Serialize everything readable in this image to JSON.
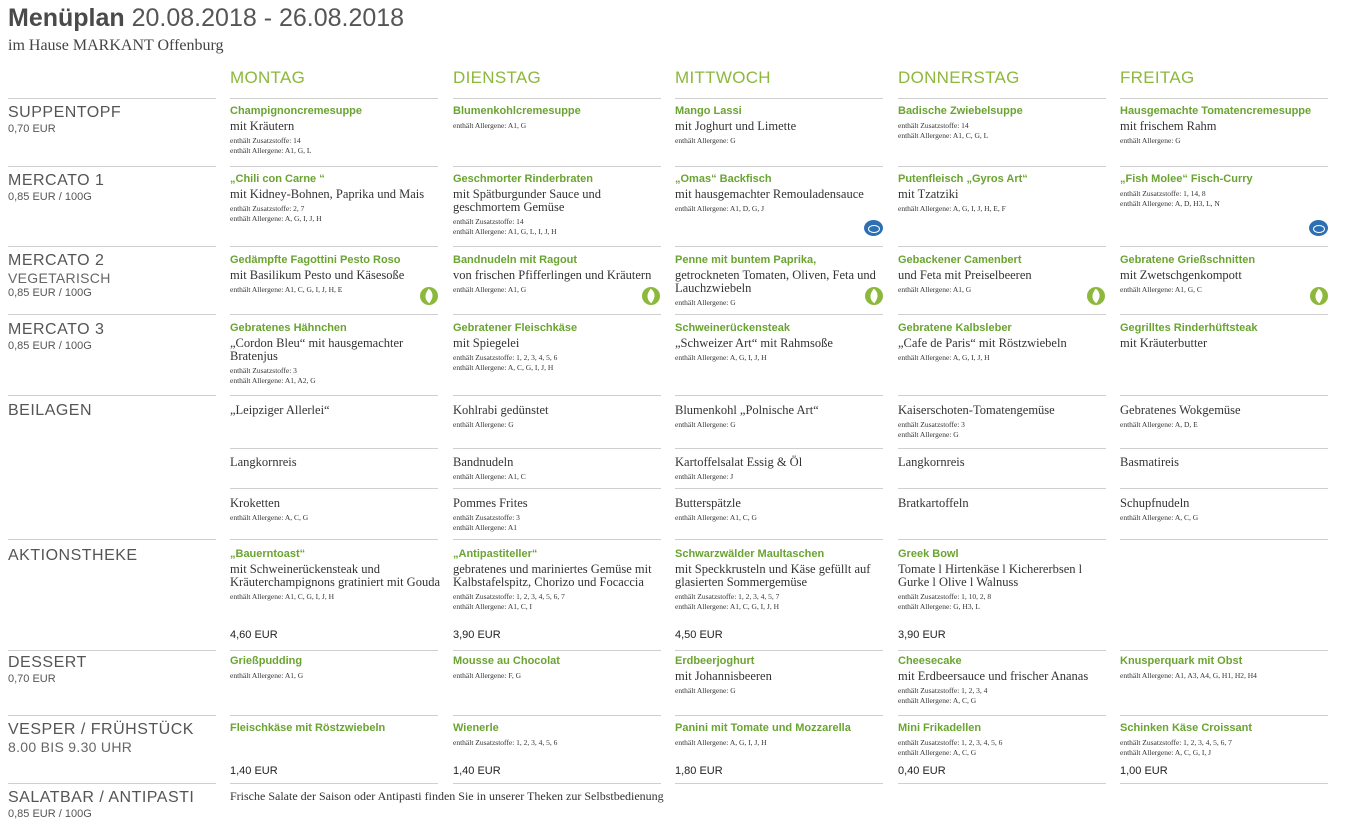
{
  "header": {
    "title": "Menüplan",
    "date_range": "20.08.2018 - 26.08.2018",
    "subtitle": "im Hause MARKANT Offenburg"
  },
  "days": [
    "MONTAG",
    "DIENSTAG",
    "MITTWOCH",
    "DONNERSTAG",
    "FREITAG"
  ],
  "rows": {
    "suppentopf": {
      "name": "SUPPENTOPF",
      "price": "0,70 EUR"
    },
    "mercato1": {
      "name": "MERCATO 1",
      "price": "0,85 EUR / 100G"
    },
    "mercato2": {
      "name": "MERCATO 2",
      "sub": "VEGETARISCH",
      "price": "0,85 EUR / 100G"
    },
    "mercato3": {
      "name": "MERCATO 3",
      "price": "0,85 EUR / 100G"
    },
    "beilagen": {
      "name": "BEILAGEN"
    },
    "aktion": {
      "name": "AKTIONSTHEKE"
    },
    "dessert": {
      "name": "DESSERT",
      "price": "0,70 EUR"
    },
    "vesper": {
      "name": "VESPER / FRÜHSTÜCK",
      "sub": "8.00 BIS 9.30 UHR"
    },
    "salat": {
      "name": "SALATBAR / ANTIPASTI",
      "price": "0,85 EUR / 100G"
    }
  },
  "suppentopf": [
    {
      "dish": "Champignoncremesuppe",
      "desc": "mit Kräutern",
      "notes": [
        "enthält Zusatzstoffe: 14",
        "enthält Allergene: A1, G, L"
      ]
    },
    {
      "dish": "Blumenkohlcremesuppe",
      "desc": "",
      "notes": [
        "enthält Allergene: A1, G"
      ]
    },
    {
      "dish": "Mango Lassi",
      "desc": "mit Joghurt und Limette",
      "notes": [
        "enthält Allergene: G"
      ]
    },
    {
      "dish": "Badische Zwiebelsuppe",
      "desc": "",
      "notes": [
        "enthält Zusatzstoffe: 14",
        "enthält Allergene: A1, C, G, L"
      ]
    },
    {
      "dish": "Hausgemachte Tomatencremesuppe",
      "desc": "mit frischem Rahm",
      "notes": [
        "enthält Allergene: G"
      ]
    }
  ],
  "mercato1": [
    {
      "dish": "„Chili con Carne “",
      "desc": "mit Kidney-Bohnen, Paprika und Mais",
      "notes": [
        "enthält Zusatzstoffe: 2, 7",
        "enthält Allergene: A, G, I, J, H"
      ]
    },
    {
      "dish": "Geschmorter Rinderbraten",
      "desc": "mit Spätburgunder Sauce und geschmortem Gemüse",
      "notes": [
        "enthält Zusatzstoffe: 14",
        "enthält Allergene: A1, G, L, I, J, H"
      ]
    },
    {
      "dish": "„Omas“ Backfisch",
      "desc": "mit hausgemachter Remouladensauce",
      "notes": [
        "enthält Allergene: A1, D, G, J"
      ]
    },
    {
      "dish": "Putenfleisch „Gyros Art“",
      "desc": "mit Tzatziki",
      "notes": [
        "enthält Allergene: A, G, I, J, H, E, F"
      ]
    },
    {
      "dish": "„Fish Molee“ Fisch-Curry",
      "desc": "",
      "notes": [
        "enthält Zusatzstoffe: 1, 14, 8",
        "enthält Allergene: A, D, H3, L, N"
      ]
    }
  ],
  "mercato2": [
    {
      "dish": "Gedämpfte Fagottini Pesto Roso",
      "desc": "mit Basilikum Pesto und Käsesoße",
      "notes": [
        "enthält Allergene: A1, C, G, I, J, H, E"
      ]
    },
    {
      "dish": "Bandnudeln mit Ragout",
      "desc": "von frischen Pfifferlingen und Kräutern",
      "notes": [
        "enthält Allergene: A1, G"
      ]
    },
    {
      "dish": "Penne mit buntem Paprika,",
      "desc": "getrockneten Tomaten, Oliven, Feta und Lauchzwiebeln",
      "notes": [
        "enthält Allergene: G"
      ]
    },
    {
      "dish": "Gebackener Camenbert",
      "desc": "und Feta mit Preiselbeeren",
      "notes": [
        "enthält Allergene: A1, G"
      ]
    },
    {
      "dish": "Gebratene Grießschnitten",
      "desc": "mit Zwetschgenkompott",
      "notes": [
        "enthält Allergene: A1, G, C"
      ]
    }
  ],
  "mercato3": [
    {
      "dish": "Gebratenes Hähnchen",
      "desc": "„Cordon Bleu“ mit hausgemachter Bratenjus",
      "notes": [
        "enthält Zusatzstoffe: 3",
        "enthält Allergene: A1, A2, G"
      ]
    },
    {
      "dish": "Gebratener Fleischkäse",
      "desc": "mit Spiegelei",
      "notes": [
        "enthält Zusatzstoffe: 1, 2, 3, 4, 5, 6",
        "enthält Allergene: A, C, G, I, J, H"
      ]
    },
    {
      "dish": "Schweinerückensteak",
      "desc": "„Schweizer Art“ mit Rahmsoße",
      "notes": [
        "enthält Allergene: A, G, I, J, H"
      ]
    },
    {
      "dish": "Gebratene Kalbsleber",
      "desc": "„Cafe de Paris“ mit Röstzwiebeln",
      "notes": [
        "enthält Allergene: A, G, I, J, H"
      ]
    },
    {
      "dish": "Gegrilltes Rinderhüftsteak",
      "desc": "mit Kräuterbutter",
      "notes": []
    }
  ],
  "beilagen": [
    [
      {
        "desc": "„Leipziger Allerlei“",
        "notes": []
      },
      {
        "desc": "Kohlrabi gedünstet",
        "notes": [
          "enthält Allergene: G"
        ]
      },
      {
        "desc": "Blumenkohl „Polnische Art“",
        "notes": [
          "enthält Allergene: G"
        ]
      },
      {
        "desc": "Kaiserschoten-Tomatengemüse",
        "notes": [
          "enthält Zusatzstoffe: 3",
          "enthält Allergene: G"
        ]
      },
      {
        "desc": "Gebratenes Wokgemüse",
        "notes": [
          "enthält Allergene: A, D, E"
        ]
      }
    ],
    [
      {
        "desc": "Langkornreis",
        "notes": []
      },
      {
        "desc": "Bandnudeln",
        "notes": [
          "enthält Allergene: A1, C"
        ]
      },
      {
        "desc": "Kartoffelsalat Essig & Öl",
        "notes": [
          "enthält Allergene: J"
        ]
      },
      {
        "desc": "Langkornreis",
        "notes": []
      },
      {
        "desc": "Basmatireis",
        "notes": []
      }
    ],
    [
      {
        "desc": "Kroketten",
        "notes": [
          "enthält Allergene: A, C, G"
        ]
      },
      {
        "desc": "Pommes Frites",
        "notes": [
          "enthält Zusatzstoffe: 3",
          "enthält Allergene: A1"
        ]
      },
      {
        "desc": "Butterspätzle",
        "notes": [
          "enthält Allergene: A1, C, G"
        ]
      },
      {
        "desc": "Bratkartoffeln",
        "notes": []
      },
      {
        "desc": "Schupfnudeln",
        "notes": [
          "enthält Allergene: A, C, G"
        ]
      }
    ]
  ],
  "aktion": [
    {
      "dish": "„Bauerntoast“",
      "desc": "mit Schweinerückensteak und Kräuterchampignons gratiniert mit Gouda",
      "notes": [
        "enthält Allergene: A1, C, G, I, J, H"
      ],
      "price": "4,60 EUR"
    },
    {
      "dish": "„Antipastiteller“",
      "desc": "gebratenes und mariniertes Gemüse mit Kalbstafelspitz, Chorizo und Focaccia",
      "notes": [
        "enthält Zusatzstoffe: 1, 2, 3, 4, 5, 6, 7",
        "enthält Allergene: A1, C, I"
      ],
      "price": "3,90 EUR"
    },
    {
      "dish": "Schwarzwälder Maultaschen",
      "desc": "mit Speckkrusteln und Käse gefüllt auf glasierten Sommergemüse",
      "notes": [
        "enthält Zusatzstoffe: 1, 2, 3, 4, 5, 7",
        "enthält Allergene: A1, C, G, I, J, H"
      ],
      "price": "4,50 EUR"
    },
    {
      "dish": "Greek Bowl",
      "desc": "Tomate l Hirtenkäse l Kichererbsen l Gurke l Olive l Walnuss",
      "notes": [
        "enthält Zusatzstoffe: 1, 10, 2, 8",
        "enthält Allergene: G, H3, L"
      ],
      "price": "3,90 EUR"
    },
    {
      "dish": "",
      "desc": "",
      "notes": [],
      "price": ""
    }
  ],
  "dessert": [
    {
      "dish": "Grießpudding",
      "desc": "",
      "notes": [
        "enthält Allergene: A1, G"
      ]
    },
    {
      "dish": "Mousse au Chocolat",
      "desc": "",
      "notes": [
        "enthält Allergene: F, G"
      ]
    },
    {
      "dish": "Erdbeerjoghurt",
      "desc": "mit Johannisbeeren",
      "notes": [
        "enthält Allergene: G"
      ]
    },
    {
      "dish": "Cheesecake",
      "desc": "mit Erdbeersauce und frischer Ananas",
      "notes": [
        "enthält Zusatzstoffe: 1, 2, 3, 4",
        "enthält Allergene: A, C, G"
      ]
    },
    {
      "dish": "Knusperquark mit Obst",
      "desc": "",
      "notes": [
        "enthält Allergene: A1, A3, A4, G, H1, H2, H4"
      ]
    }
  ],
  "vesper": [
    {
      "dish": "Fleischkäse mit Röstzwiebeln",
      "desc": "",
      "notes": [],
      "price": "1,40 EUR"
    },
    {
      "dish": "Wienerle",
      "desc": "",
      "notes": [
        "enthält Zusatzstoffe: 1, 2, 3, 4, 5, 6"
      ],
      "price": "1,40 EUR"
    },
    {
      "dish": "Panini mit Tomate und Mozzarella",
      "desc": "",
      "notes": [
        "enthält Allergene: A, G, I, J, H"
      ],
      "price": "1,80 EUR"
    },
    {
      "dish": "Mini Frikadellen",
      "desc": "",
      "notes": [
        "enthält Zusatzstoffe: 1, 2, 3, 4, 5, 6",
        "enthält Allergene: A, C, G"
      ],
      "price": "0,40 EUR"
    },
    {
      "dish": "Schinken Käse Croissant",
      "desc": "",
      "notes": [
        "enthält Zusatzstoffe: 1, 2, 3, 4, 5, 6, 7",
        "enthält Allergene: A, C, G, I, J"
      ],
      "price": "1,00 EUR"
    }
  ],
  "salat_text": "Frische Salate der Saison oder Antipasti finden Sie in unserer Theken zur Selbstbedienung",
  "icons": {
    "vegetarian": "leaf-icon",
    "fish": "fish-icon",
    "accent_green": "#8cb83b",
    "dish_green": "#6aa431",
    "fish_blue": "#2d6fb3"
  }
}
